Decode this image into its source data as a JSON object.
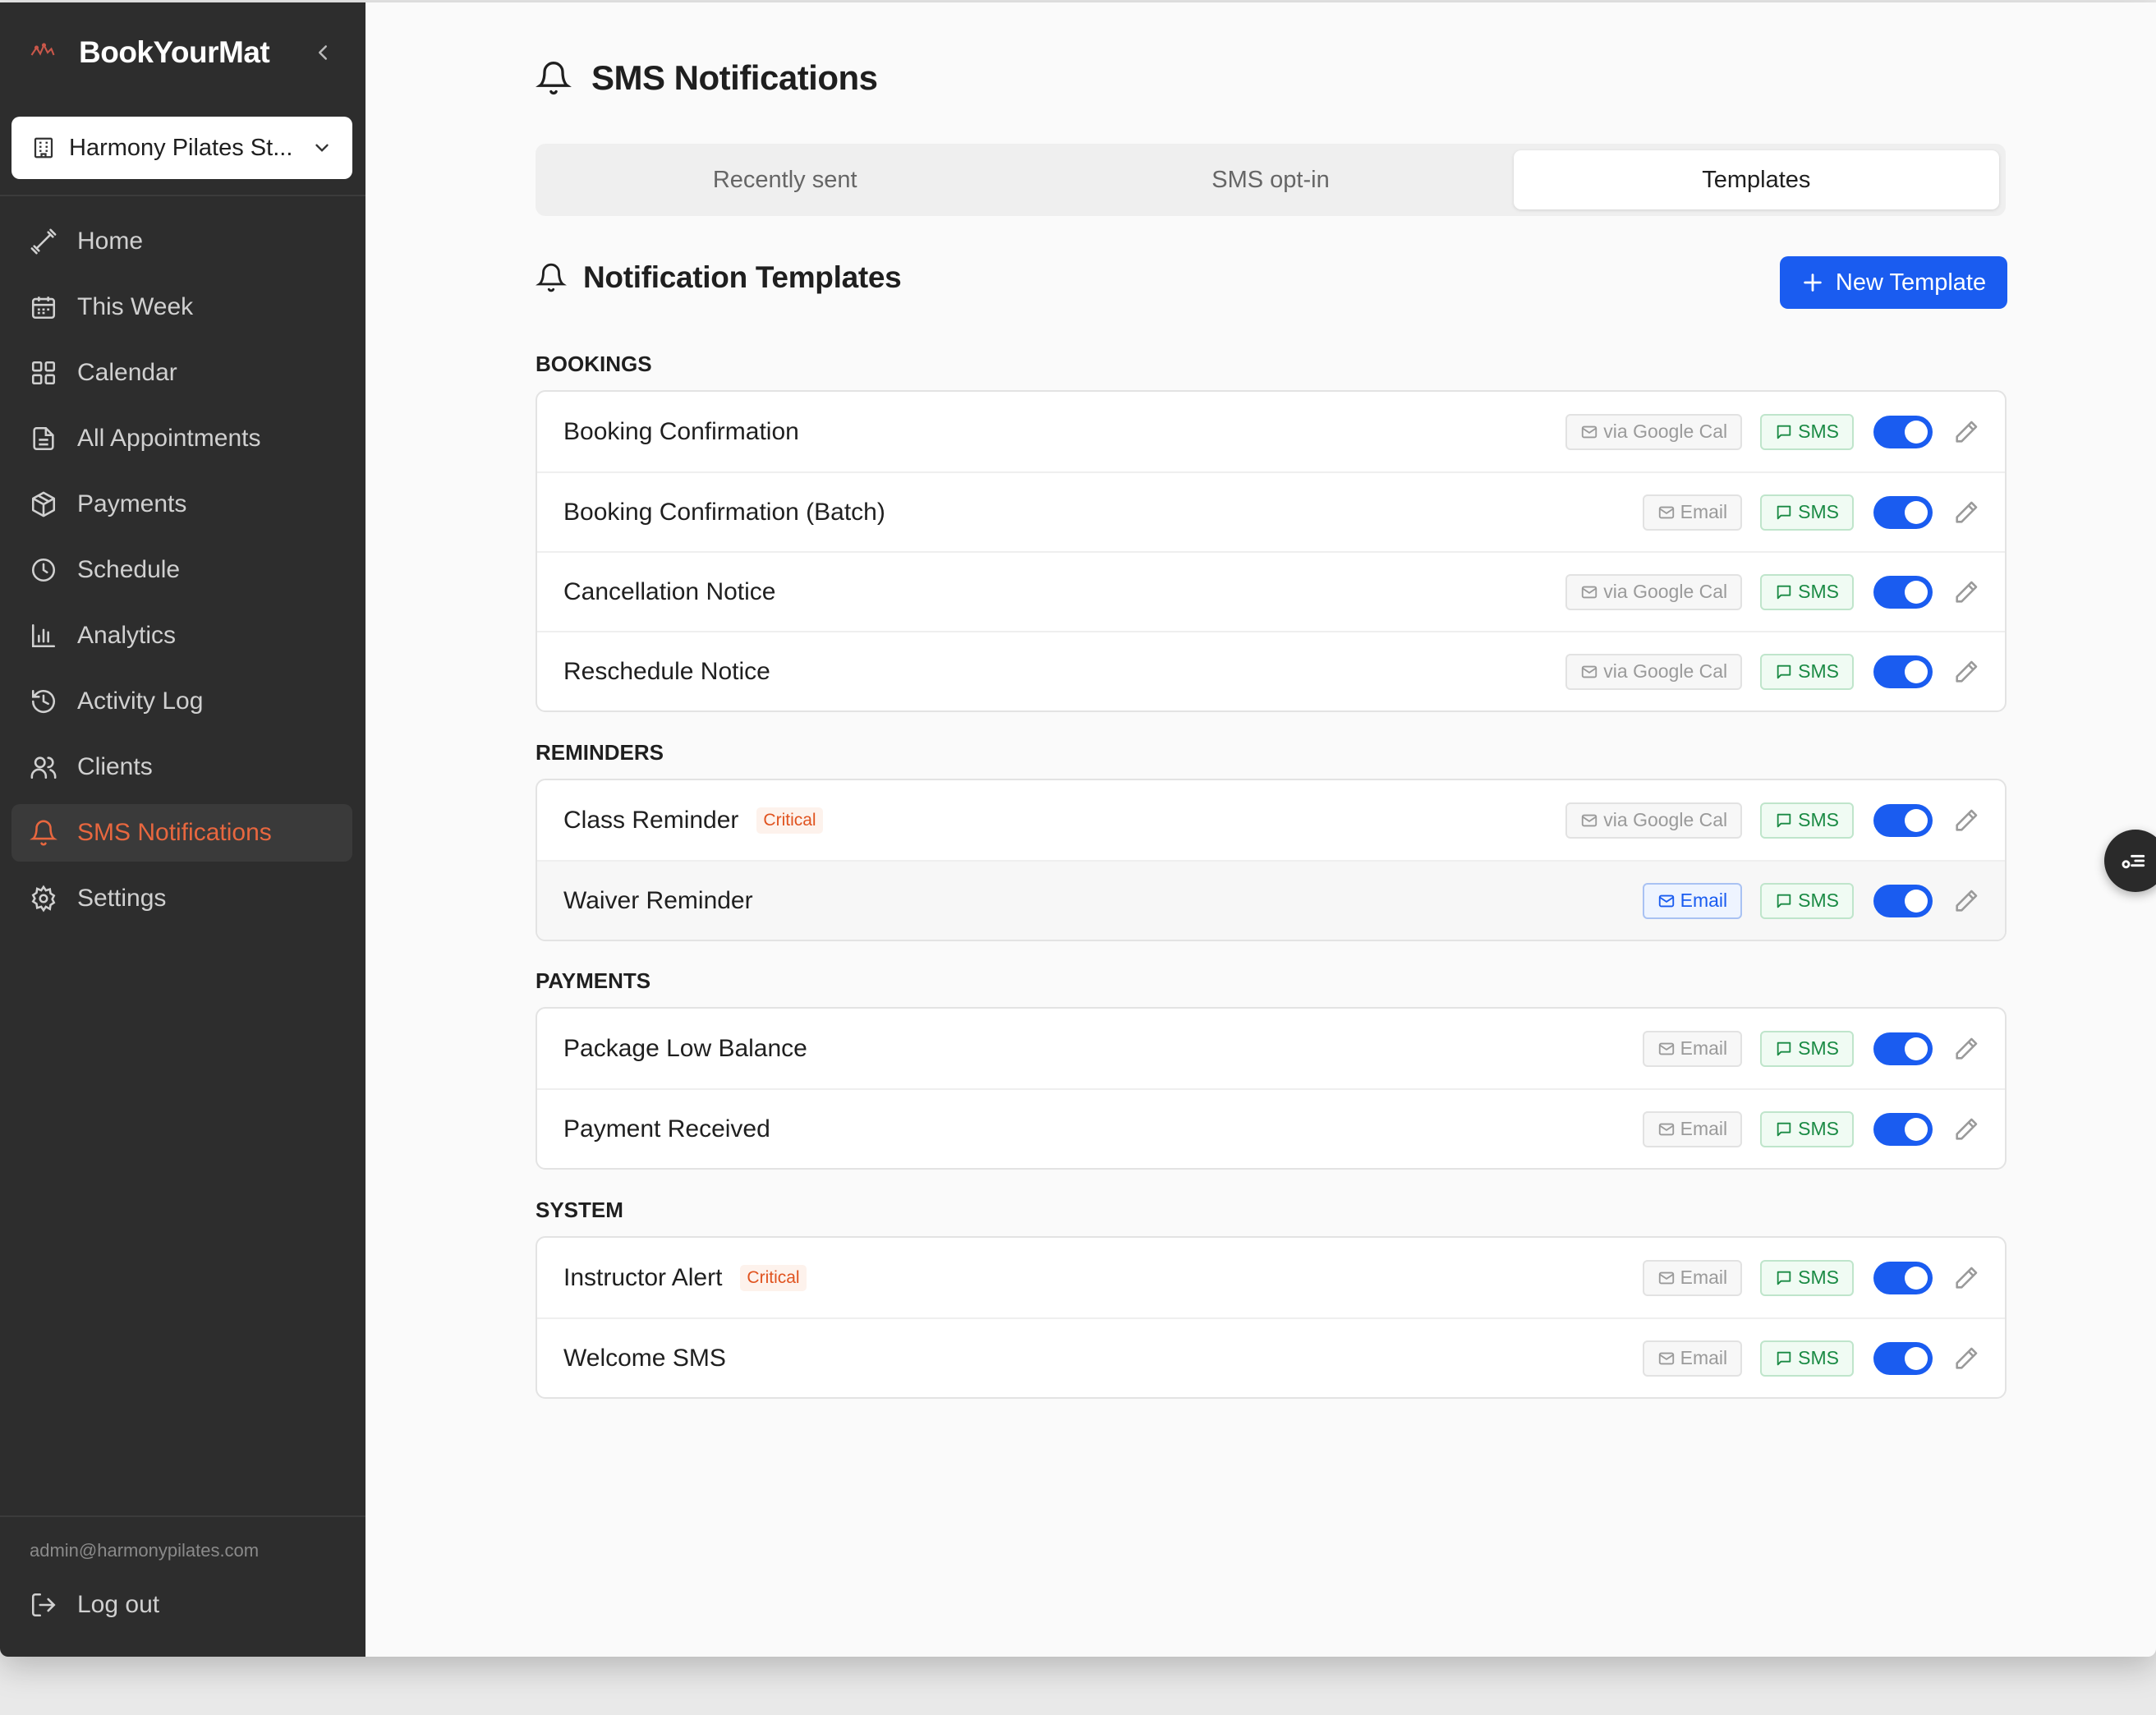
{
  "app": {
    "name": "BookYourMat"
  },
  "sidebar": {
    "studio": "Harmony Pilates St...",
    "items": [
      {
        "label": "Home",
        "icon": "dumbbell-icon"
      },
      {
        "label": "This Week",
        "icon": "calendar-week-icon"
      },
      {
        "label": "Calendar",
        "icon": "grid-icon"
      },
      {
        "label": "All Appointments",
        "icon": "document-icon"
      },
      {
        "label": "Payments",
        "icon": "package-icon"
      },
      {
        "label": "Schedule",
        "icon": "clock-icon"
      },
      {
        "label": "Analytics",
        "icon": "bar-chart-icon"
      },
      {
        "label": "Activity Log",
        "icon": "history-icon"
      },
      {
        "label": "Clients",
        "icon": "users-icon"
      },
      {
        "label": "SMS Notifications",
        "icon": "bell-icon",
        "active": true
      },
      {
        "label": "Settings",
        "icon": "gear-icon"
      }
    ],
    "email": "admin@harmonypilates.com",
    "logout": "Log out"
  },
  "page": {
    "title": "SMS Notifications",
    "tabs": [
      {
        "label": "Recently sent"
      },
      {
        "label": "SMS opt-in"
      },
      {
        "label": "Templates",
        "active": true
      }
    ],
    "section_title": "Notification Templates",
    "new_button": "New Template"
  },
  "groups": [
    {
      "label": "BOOKINGS",
      "rows": [
        {
          "name": "Booking Confirmation",
          "email": "via Google Cal",
          "sms": "SMS"
        },
        {
          "name": "Booking Confirmation (Batch)",
          "email": "Email",
          "sms": "SMS"
        },
        {
          "name": "Cancellation Notice",
          "email": "via Google Cal",
          "sms": "SMS"
        },
        {
          "name": "Reschedule Notice",
          "email": "via Google Cal",
          "sms": "SMS"
        }
      ]
    },
    {
      "label": "REMINDERS",
      "rows": [
        {
          "name": "Class Reminder",
          "badge": "Critical",
          "email": "via Google Cal",
          "sms": "SMS"
        },
        {
          "name": "Waiver Reminder",
          "email": "Email",
          "sms": "SMS"
        }
      ]
    },
    {
      "label": "PAYMENTS",
      "rows": [
        {
          "name": "Package Low Balance",
          "email": "Email",
          "sms": "SMS"
        },
        {
          "name": "Payment Received",
          "email": "Email",
          "sms": "SMS"
        }
      ]
    },
    {
      "label": "SYSTEM",
      "rows": [
        {
          "name": "Instructor Alert",
          "badge": "Critical",
          "email": "Email",
          "sms": "SMS"
        },
        {
          "name": "Welcome SMS",
          "email": "Email",
          "sms": "SMS"
        }
      ]
    }
  ],
  "colors": {
    "accent": "#1a5cf0",
    "active_nav": "#e8673f",
    "sidebar_bg": "#2d2d2d",
    "sms_green": "#1a8a44",
    "critical": "#e0531f"
  }
}
